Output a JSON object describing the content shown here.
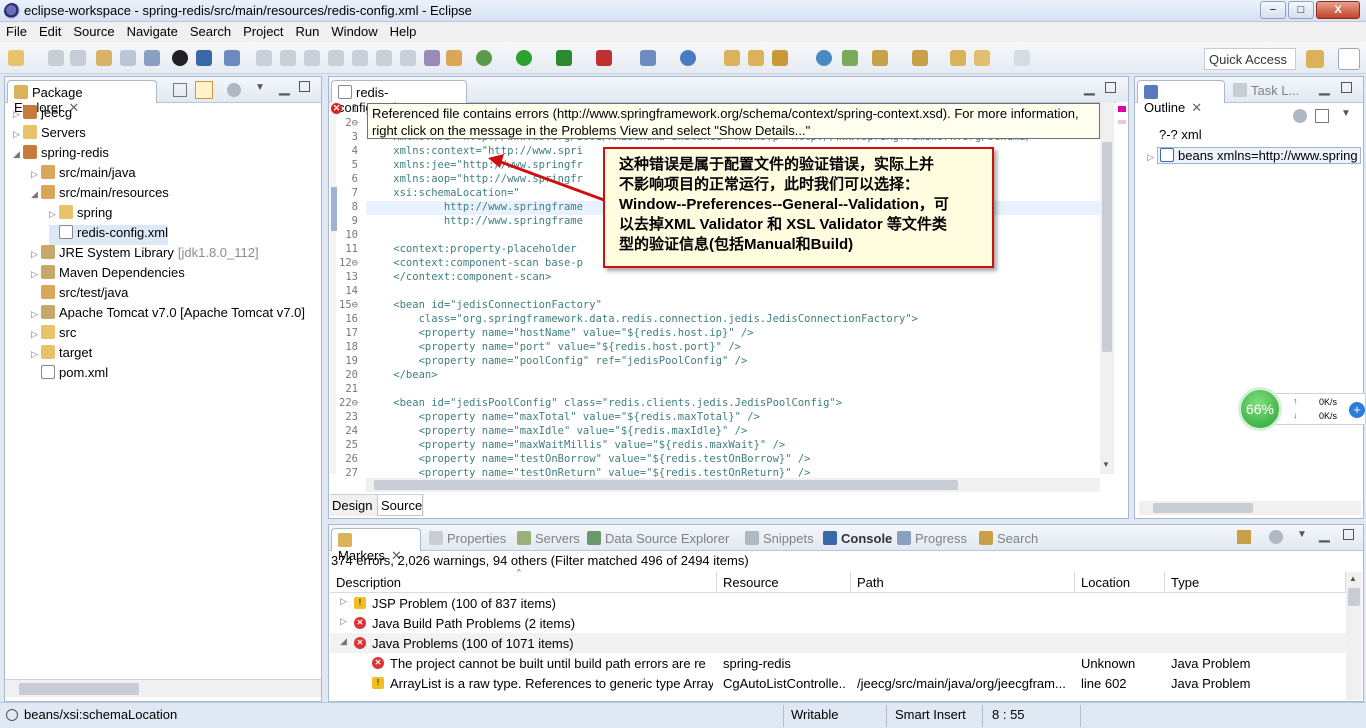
{
  "window": {
    "title": "eclipse-workspace - spring-redis/src/main/resources/redis-config.xml - Eclipse",
    "minimize": "−",
    "maximize": "□",
    "close": "X"
  },
  "menu": [
    "File",
    "Edit",
    "Source",
    "Navigate",
    "Search",
    "Project",
    "Run",
    "Window",
    "Help"
  ],
  "quick_access": {
    "placeholder": "Quick Access"
  },
  "package_explorer": {
    "tab_label": "Package Explorer",
    "items": [
      {
        "label": "jeecg",
        "depth": 0,
        "icon": "project-icon"
      },
      {
        "label": "Servers",
        "depth": 0,
        "icon": "folder-icon"
      },
      {
        "label": "spring-redis",
        "depth": 0,
        "icon": "project-icon"
      },
      {
        "label": "src/main/java",
        "depth": 1,
        "icon": "source-folder-icon"
      },
      {
        "label": "src/main/resources",
        "depth": 1,
        "icon": "source-folder-icon"
      },
      {
        "label": "spring",
        "depth": 2,
        "icon": "folder-icon"
      },
      {
        "label": "redis-config.xml",
        "depth": 2,
        "icon": "xml-file-icon"
      },
      {
        "label": "JRE System Library",
        "suffix": "[jdk1.8.0_112]",
        "depth": 1,
        "icon": "library-icon"
      },
      {
        "label": "Maven Dependencies",
        "depth": 1,
        "icon": "library-icon"
      },
      {
        "label": "src/test/java",
        "depth": 1,
        "icon": "source-folder-icon"
      },
      {
        "label": "Apache Tomcat v7.0 [Apache Tomcat v7.0]",
        "depth": 1,
        "icon": "library-icon"
      },
      {
        "label": "src",
        "depth": 1,
        "icon": "folder-icon"
      },
      {
        "label": "target",
        "depth": 1,
        "icon": "folder-icon"
      },
      {
        "label": "pom.xml",
        "depth": 1,
        "icon": "xml-file-icon"
      }
    ]
  },
  "editor": {
    "tab_label": "redis-config.xml",
    "tooltip_line1": "Referenced file contains errors (http://www.springframework.org/schema/context/spring-context.xsd). For more information,",
    "tooltip_line2": "right click on the message in the Problems View and select \"Show Details...\"",
    "lines": [
      {
        "n": "1",
        "text": ""
      },
      {
        "n": "2⊖",
        "text": ""
      },
      {
        "n": "3",
        "text": "    xmlns:xsi=\"http://www.w3.org/2001/XMLSchema-instance\" xmlns:p=\"http://www.springframework.org/schema/"
      },
      {
        "n": "4",
        "text": "    xmlns:context=\"http://www.spri"
      },
      {
        "n": "5",
        "text": "    xmlns:jee=\"http://www.springfr                                                  work.org/schema"
      },
      {
        "n": "6",
        "text": "    xmlns:aop=\"http://www.springfr"
      },
      {
        "n": "7",
        "text": "    xsi:schemaLocation=\""
      },
      {
        "n": "8",
        "text": "            http://www.springframe                                                  ema/beans/sprin"
      },
      {
        "n": "9",
        "text": "            http://www.springframe                                                  hema/context/s"
      },
      {
        "n": "10",
        "text": ""
      },
      {
        "n": "11",
        "text": "    <context:property-placeholder"
      },
      {
        "n": "12⊖",
        "text": "    <context:component-scan base-p"
      },
      {
        "n": "13",
        "text": "    </context:component-scan>"
      },
      {
        "n": "14",
        "text": ""
      },
      {
        "n": "15⊖",
        "text": "    <bean id=\"jedisConnectionFactory\""
      },
      {
        "n": "16",
        "text": "        class=\"org.springframework.data.redis.connection.jedis.JedisConnectionFactory\">"
      },
      {
        "n": "17",
        "text": "        <property name=\"hostName\" value=\"${redis.host.ip}\" />"
      },
      {
        "n": "18",
        "text": "        <property name=\"port\" value=\"${redis.host.port}\" />"
      },
      {
        "n": "19",
        "text": "        <property name=\"poolConfig\" ref=\"jedisPoolConfig\" />"
      },
      {
        "n": "20",
        "text": "    </bean>"
      },
      {
        "n": "21",
        "text": ""
      },
      {
        "n": "22⊖",
        "text": "    <bean id=\"jedisPoolConfig\" class=\"redis.clients.jedis.JedisPoolConfig\">"
      },
      {
        "n": "23",
        "text": "        <property name=\"maxTotal\" value=\"${redis.maxTotal}\" />"
      },
      {
        "n": "24",
        "text": "        <property name=\"maxIdle\" value=\"${redis.maxIdle}\" />"
      },
      {
        "n": "25",
        "text": "        <property name=\"maxWaitMillis\" value=\"${redis.maxWait}\" />"
      },
      {
        "n": "26",
        "text": "        <property name=\"testOnBorrow\" value=\"${redis.testOnBorrow}\" />"
      },
      {
        "n": "27",
        "text": "        <property name=\"testOnReturn\" value=\"${redis.testOnReturn}\" />"
      }
    ],
    "bottom_tabs": {
      "design": "Design",
      "source": "Source"
    }
  },
  "callout": {
    "line1": "这种错误是属于配置文件的验证错误，实际上并",
    "line2": "不影响项目的正常运行，此时我们可以选择：",
    "line3": "Window--Preferences--General--Validation，可",
    "line4": "以去掉XML Validator 和 XSL Validator 等文件类",
    "line5": "型的验证信息(包括Manual和Build)"
  },
  "outline": {
    "tab_label": "Outline",
    "task_tab": "Task L...",
    "items": [
      {
        "label": "?-? xml"
      },
      {
        "label": "beans xmlns=http://www.spring"
      }
    ]
  },
  "net_widget": {
    "percent": "66%",
    "up": "0K/s",
    "down": "0K/s"
  },
  "bottom_panel": {
    "tabs": [
      "Markers",
      "Properties",
      "Servers",
      "Data Source Explorer",
      "Snippets",
      "Console",
      "Progress",
      "Search"
    ],
    "summary": "374 errors, 2,026 warnings, 94 others (Filter matched 496 of 2494 items)",
    "columns": [
      "Description",
      "Resource",
      "Path",
      "Location",
      "Type"
    ],
    "rows": [
      {
        "kind": "group",
        "icon": "warning-icon",
        "expanded": false,
        "description": "JSP Problem (100 of 837 items)",
        "resource": "",
        "path": "",
        "location": "",
        "type": ""
      },
      {
        "kind": "group",
        "icon": "error-icon",
        "expanded": false,
        "description": "Java Build Path Problems (2 items)",
        "resource": "",
        "path": "",
        "location": "",
        "type": ""
      },
      {
        "kind": "group",
        "icon": "error-icon",
        "expanded": true,
        "description": "Java Problems (100 of 1071 items)",
        "resource": "",
        "path": "",
        "location": "",
        "type": ""
      },
      {
        "kind": "item",
        "icon": "error-icon",
        "description": "The project cannot be built until build path errors are re",
        "resource": "spring-redis",
        "path": "",
        "location": "Unknown",
        "type": "Java Problem"
      },
      {
        "kind": "item",
        "icon": "warning-icon",
        "description": "ArrayList is a raw type. References to generic type Array",
        "resource": "CgAutoListControlle...",
        "path": "/jeecg/src/main/java/org/jeecgfram...",
        "location": "line 602",
        "type": "Java Problem"
      }
    ]
  },
  "status": {
    "left": "beans/xsi:schemaLocation",
    "writable": "Writable",
    "insert": "Smart Insert",
    "position": "8 : 55"
  }
}
